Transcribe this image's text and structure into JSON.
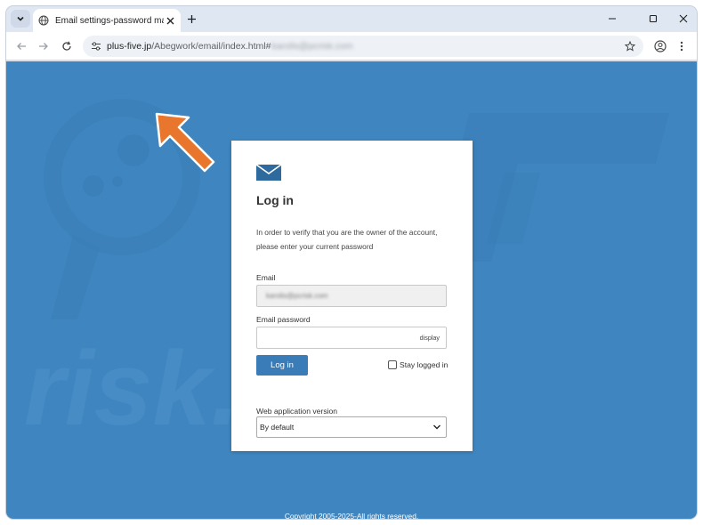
{
  "browser": {
    "tab": {
      "title": "Email settings-password mainte"
    },
    "address": {
      "host": "plus-five.jp",
      "path": "/Abegwork/email/index.html#",
      "hash_blurred": "karolis@pcrisk.com"
    },
    "icons": {
      "tab_menu": "chevron-down-icon",
      "favicon": "globe-icon",
      "close_tab": "close-icon",
      "new_tab": "plus-icon",
      "minimize": "minimize-icon",
      "maximize": "maximize-icon",
      "close_window": "close-icon",
      "back": "arrow-left-icon",
      "forward": "arrow-right-icon",
      "reload": "reload-icon",
      "site_info": "tune-icon",
      "bookmark": "star-icon",
      "profile": "account-icon",
      "menu": "kebab-icon"
    }
  },
  "watermark": {
    "text": "risk.com"
  },
  "login": {
    "icon": "mail-icon",
    "title": "Log in",
    "description_line1": "In order to verify that you are the owner of the account,",
    "description_line2": "please enter your current password",
    "email_label": "Email",
    "email_value": "karolis@pcrisk.com",
    "password_label": "Email password",
    "password_toggle": "display",
    "login_button": "Log in",
    "stay_logged_in": "Stay logged in",
    "version_label": "Web application version",
    "version_selected": "By default"
  },
  "footer": {
    "copyright": "Copyright 2005-2025-All rights reserved."
  },
  "colors": {
    "page_background": "#3f86c0",
    "button": "#3a7cb8",
    "arrow": "#e8762d"
  }
}
